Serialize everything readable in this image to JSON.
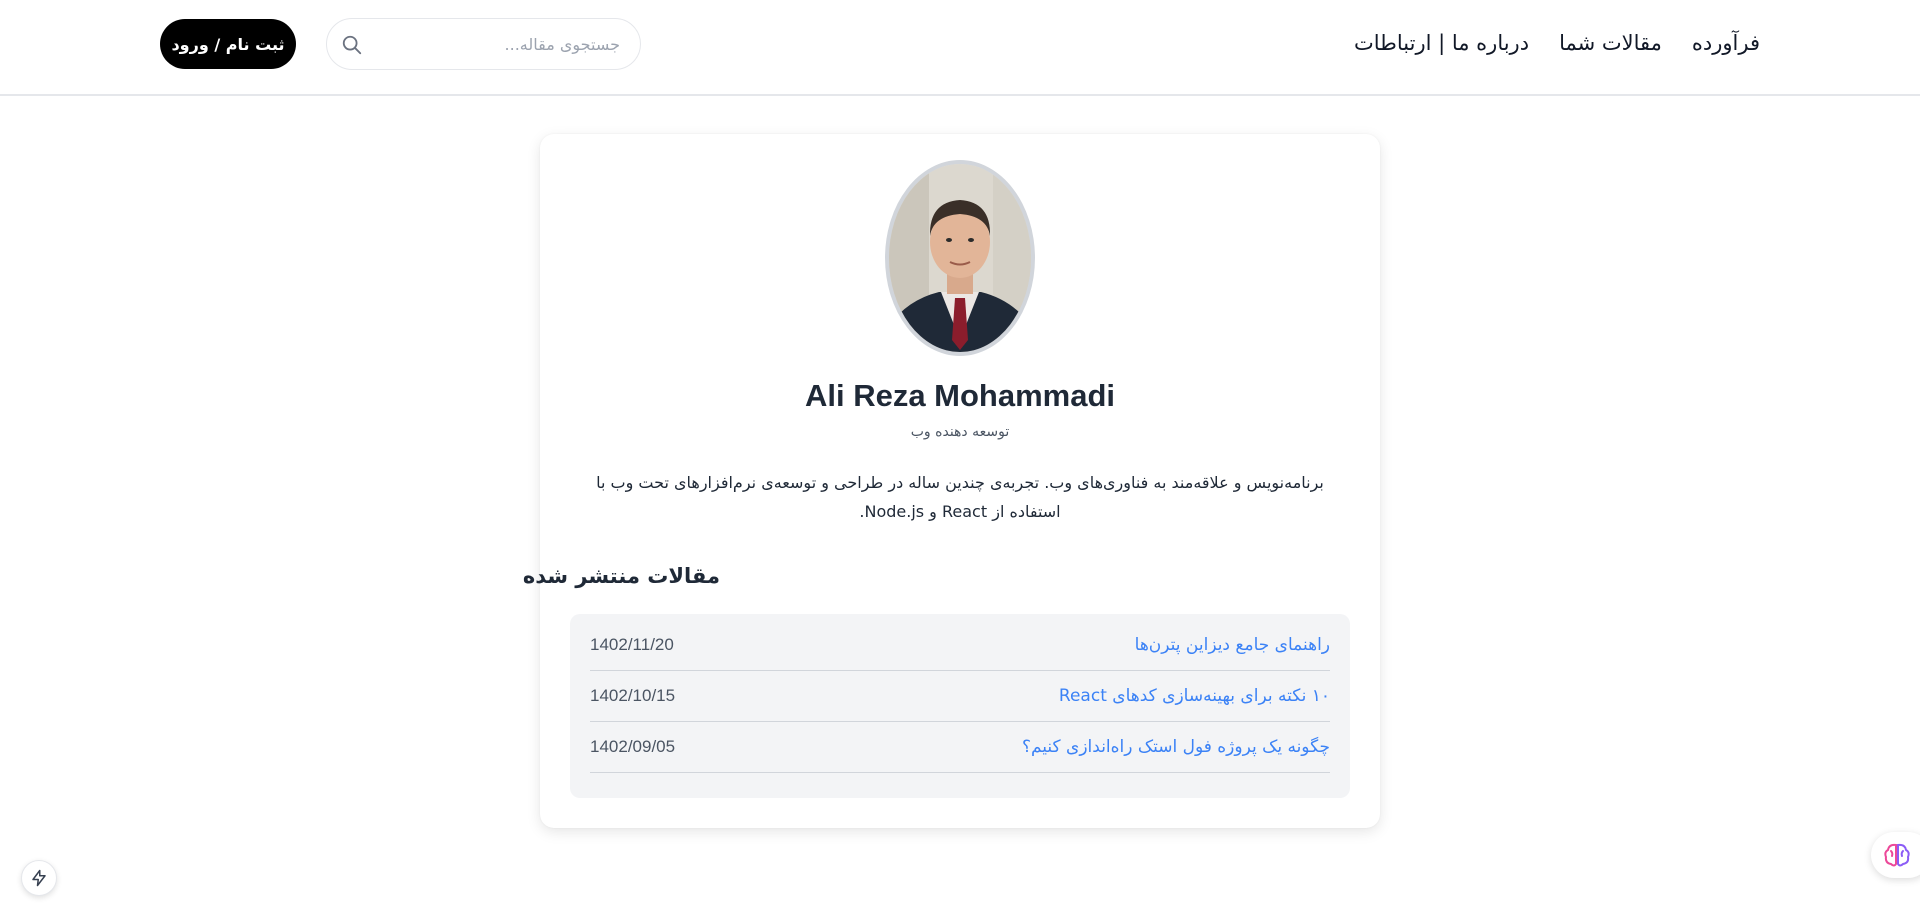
{
  "header": {
    "nav": [
      {
        "label": "فرآورده"
      },
      {
        "label": "مقالات شما"
      },
      {
        "label": "درباره ما | ارتباطات"
      }
    ],
    "search_placeholder": "جستجوی مقاله...",
    "search_icon": "search-icon",
    "login_label": "ثبت نام / ورود"
  },
  "profile": {
    "name": "Ali Reza Mohammadi",
    "role": "توسعه دهنده وب",
    "bio": "برنامه‌نویس و علاقه‌مند به فناوری‌های وب. تجربه‌ی چندین ساله در طراحی و توسعه‌ی نرم‌افزارهای تحت وب با استفاده از React و Node.js."
  },
  "articles": {
    "title": "مقالات منتشر شده",
    "items": [
      {
        "title": "راهنمای جامع دیزاین پترن‌ها",
        "date": "1402/11/20"
      },
      {
        "title": "۱۰ نکته برای بهینه‌سازی کدهای React",
        "date": "1402/10/15"
      },
      {
        "title": "چگونه یک پروژه فول استک راه‌اندازی کنیم؟",
        "date": "1402/09/05"
      }
    ]
  },
  "widgets": {
    "left_icon": "bolt-icon",
    "right_icon": "brain-icon"
  },
  "colors": {
    "link": "#3b82f6",
    "button_bg": "#000000",
    "panel_bg": "#f3f4f6"
  }
}
